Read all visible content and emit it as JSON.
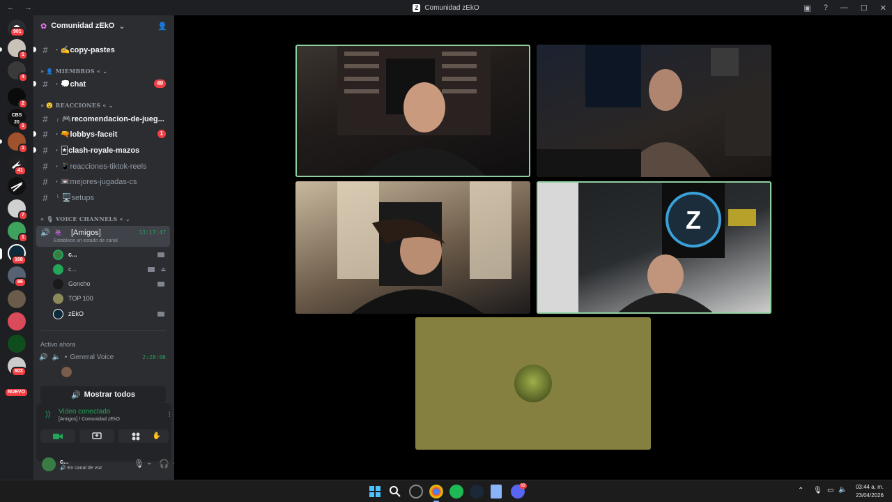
{
  "window": {
    "title": "Comunidad zEkO",
    "back": "←",
    "forward": "→"
  },
  "rail": {
    "badges": [
      "901",
      "1",
      "4",
      "2",
      "1",
      "1",
      "41",
      "7",
      "1",
      "168",
      "86",
      "603"
    ],
    "nuevo": "NUEVO",
    "label_cbs": "CBS",
    "label_20": "20"
  },
  "server": {
    "name": "Comunidad zEkO"
  },
  "channels": {
    "copy_pastes": "✍️copy-pastes",
    "cat_miembros": "MIEMBROS",
    "chat": "💭chat",
    "chat_count": "49",
    "cat_reacciones": "REACCIONES",
    "recomendacion": "🎮recomendacion-de-jueg...",
    "lobbys": "🔫lobbys-faceit",
    "lobbys_count": "1",
    "clash": "🃏clash-royale-mazos",
    "tiktok": "📱reacciones-tiktok-reels",
    "jugadas": "📼mejores-jugadas-cs",
    "setups": "🖥️setups",
    "cat_voice": "VOICE CHANNELS"
  },
  "voice": {
    "channel": "[Amigos]",
    "timer": "13:17:47",
    "status_hint": "Establece un estado de canal",
    "users": [
      "c...",
      "c...",
      "Goncho",
      "TOP 100",
      "zEkO"
    ]
  },
  "active": {
    "label": "Activo ahora",
    "channel": "General Voice",
    "timer": "2:28:06"
  },
  "mostrar_todos": "Mostrar todos",
  "connection": {
    "title": "Video conectado",
    "subtitle": "[Amigos] / Comunidad zEkO"
  },
  "user": {
    "name": "c...",
    "status": "En canal de voz"
  },
  "tray": {
    "time": "03:44 a. m.",
    "date": "23/04/2026"
  },
  "taskbar": {
    "discord_badge": "99"
  },
  "colors": {
    "accent_green": "#23a55a",
    "mention_red": "#f23f43",
    "speaking": "#8fd19e",
    "olive_tile": "#85803f"
  }
}
